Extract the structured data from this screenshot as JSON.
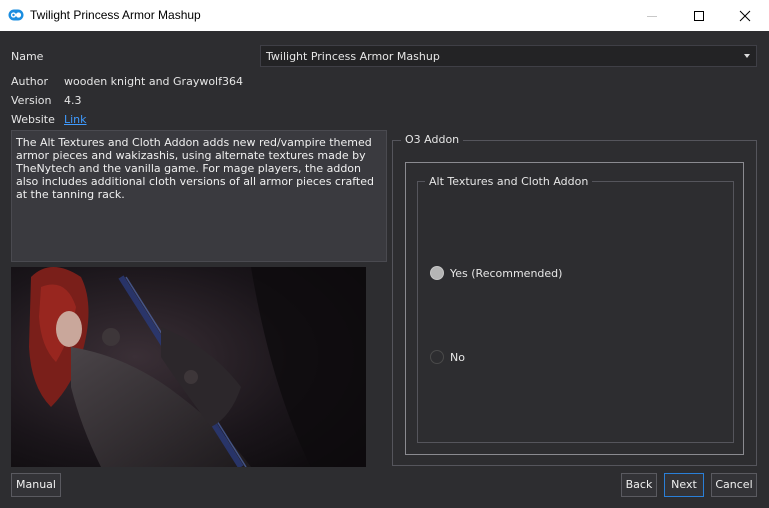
{
  "window": {
    "title": "Twilight Princess Armor Mashup",
    "minimize_icon": "minimize-icon",
    "maximize_icon": "maximize-icon",
    "close_icon": "close-icon"
  },
  "info": {
    "name_label": "Name",
    "name_value": "Twilight Princess Armor Mashup",
    "author_label": "Author",
    "author_value": "wooden knight and Graywolf364",
    "version_label": "Version",
    "version_value": "4.3",
    "website_label": "Website",
    "website_value": "Link"
  },
  "description": "The Alt Textures and Cloth Addon adds new red/vampire themed armor pieces and wakizashis, using alternate textures made by TheNytech and the vanilla game. For mage players, the addon also includes additional cloth versions of all armor pieces crafted at the tanning rack.",
  "options": {
    "group_title": "O3 Addon",
    "subgroup_title": "Alt Textures and Cloth Addon",
    "choices": [
      {
        "label": "Yes (Recommended)",
        "checked": true
      },
      {
        "label": "No",
        "checked": false
      }
    ]
  },
  "buttons": {
    "manual": "Manual",
    "back": "Back",
    "next": "Next",
    "cancel": "Cancel"
  },
  "colors": {
    "background": "#2d2d30",
    "link": "#3f9bff",
    "accent": "#2a7fd8"
  }
}
